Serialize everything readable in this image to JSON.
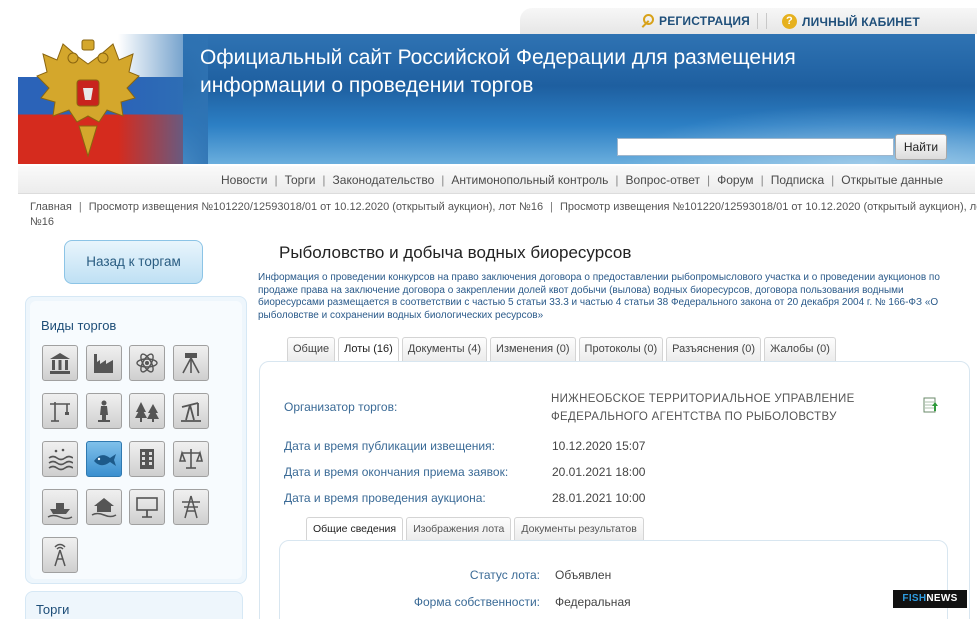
{
  "topbar": {
    "registration": "РЕГИСТРАЦИЯ",
    "cabinet": "ЛИЧНЫЙ КАБИНЕТ"
  },
  "banner": {
    "title": "Официальный сайт Российской Федерации для размещения информации о проведении торгов",
    "search_placeholder": "",
    "search_button": "Найти"
  },
  "nav": {
    "items": [
      "Новости",
      "Торги",
      "Законодательство",
      "Антимонопольный контроль",
      "Вопрос-ответ",
      "Форум",
      "Подписка",
      "Открытые данные"
    ]
  },
  "breadcrumb": {
    "home": "Главная",
    "crumb1": "Просмотр извещения №101220/12593018/01 от 10.12.2020 (открытый аукцион), лот №16",
    "crumb2": "Просмотр извещения №101220/12593018/01 от 10.12.2020 (открытый аукцион), лот №16"
  },
  "sidebar": {
    "back_button": "Назад к торгам",
    "heading": "Виды торгов",
    "icons": [
      "building-icon",
      "factory-icon",
      "atom-icon",
      "survey-tripod-icon",
      "crane-icon",
      "monument-icon",
      "forest-icon",
      "oil-pump-icon",
      "water-icon",
      "fish-icon",
      "office-building-icon",
      "scales-icon",
      "boat-icon",
      "flooded-house-icon",
      "billboard-icon",
      "power-tower-icon",
      "radio-tower-icon"
    ],
    "second_heading": "Торги"
  },
  "main": {
    "title": "Рыболовство и добыча водных биоресурсов",
    "description": "Информация о проведении конкурсов на право заключения договора о предоставлении рыбопромыслового участка и о проведении аукционов по продаже права на заключение договора о закреплении долей квот добычи (вылова) водных биоресурсов, договора пользования водными биоресурсами размещается в соответствии с частью 5 статьи 33.3 и частью 4 статьи 38 Федерального закона от 20 декабря 2004 г. № 166-ФЗ «О рыболовстве и сохранении водных биологических ресурсов»",
    "tabs": [
      "Общие",
      "Лоты (16)",
      "Документы (4)",
      "Изменения (0)",
      "Протоколы (0)",
      "Разъяснения (0)",
      "Жалобы (0)"
    ],
    "fields": {
      "organizer_label": "Организатор торгов:",
      "organizer_value": "НИЖНЕОБСКОЕ ТЕРРИТОРИАЛЬНОЕ УПРАВЛЕНИЕ ФЕДЕРАЛЬНОГО АГЕНТСТВА ПО РЫБОЛОВСТВУ",
      "published_label": "Дата и время публикации извещения:",
      "published_value": "10.12.2020 15:07",
      "deadline_label": "Дата и время окончания приема заявок:",
      "deadline_value": "20.01.2021 18:00",
      "auction_label": "Дата и время проведения аукциона:",
      "auction_value": "28.01.2021 10:00"
    },
    "subtabs": [
      "Общие сведения",
      "Изображения лота",
      "Документы результатов"
    ],
    "lot": {
      "status_label": "Статус лота:",
      "status_value": "Объявлен",
      "ownership_label": "Форма собственности:",
      "ownership_value": "Федеральная"
    }
  },
  "watermark": {
    "fish": "FISH",
    "news": "NEWS"
  }
}
